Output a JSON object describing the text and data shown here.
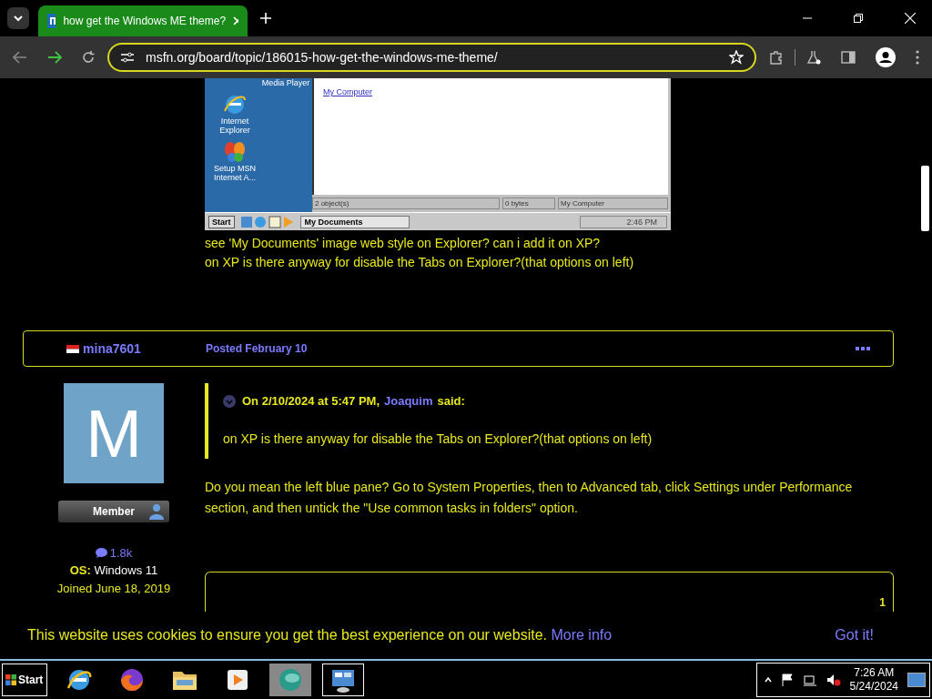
{
  "browser": {
    "tab_title": "how get the Windows ME theme?",
    "url": "msfn.org/board/topic/186015-how-get-the-windows-me-theme/"
  },
  "embedded_screenshot": {
    "top_icon_label": "Media Player",
    "desktop_icons": [
      {
        "kind": "ie",
        "label": "Internet Explorer"
      },
      {
        "kind": "msn",
        "label": "Setup MSN Internet A..."
      }
    ],
    "links": [
      "My Computer"
    ],
    "status": [
      "2 object(s)",
      "0 bytes",
      "My Computer"
    ],
    "start": "Start",
    "window_button": "My Documents",
    "clock": "2:46 PM"
  },
  "post_lines": [
    "see 'My Documents' image web style on Explorer? can i add it on XP?",
    "on XP is there anyway for disable the Tabs on Explorer?(that options on left)"
  ],
  "post": {
    "author": "mina7601",
    "posted": "Posted February 10",
    "avatar_letter": "M",
    "role": "Member",
    "post_count": "1.8k",
    "os_label": "OS:",
    "os": "Windows 11",
    "joined": "Joined June 18, 2019",
    "quote": {
      "date": "On 2/10/2024 at 5:47 PM,",
      "author": "Joaquim",
      "said": "said:",
      "text": "on XP is there anyway for disable the Tabs on Explorer?(that options on left)"
    },
    "reply": "Do you mean the left blue pane? Go to System Properties, then to Advanced tab, click Settings under Performance section, and then untick the \"Use common tasks in folders\" option."
  },
  "next_post": {
    "count": "1"
  },
  "cookie_bar": {
    "text": "This website uses cookies to ensure you get the best experience on our website.",
    "link": "More info",
    "button": "Got it!"
  },
  "taskbar": {
    "start": "Start",
    "time": "7:26 AM",
    "date": "5/24/2024"
  }
}
